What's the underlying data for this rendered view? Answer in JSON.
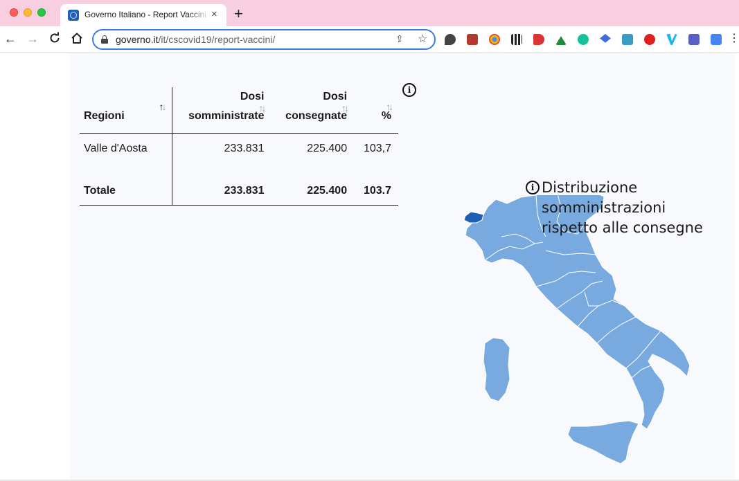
{
  "browser": {
    "tab_title": "Governo Italiano - Report Vaccini",
    "tab_close": "×",
    "new_tab": "+",
    "url_host": "governo.it",
    "url_path": "/it/cscovid19/report-vaccini/"
  },
  "table": {
    "headers": {
      "region": "Regioni",
      "administered_line1": "Dosi",
      "administered_line2": "somministrate",
      "delivered_line1": "Dosi",
      "delivered_line2": "consegnate",
      "percent": "%"
    },
    "rows": [
      {
        "region": "Valle d'Aosta",
        "administered": "233.831",
        "delivered": "225.400",
        "percent": "103,7"
      }
    ],
    "total": {
      "label": "Totale",
      "administered": "233.831",
      "delivered": "225.400",
      "percent": "103.7"
    }
  },
  "map": {
    "legend_line1": "Distribuzione",
    "legend_line2": "somministrazioni",
    "legend_line3": "rispetto alle consegne",
    "selected_region": "Valle d'Aosta",
    "region_color": "#79aadf",
    "highlight_color": "#1e5fb4"
  },
  "icons": {
    "info": "i",
    "sort": "↑↓"
  }
}
